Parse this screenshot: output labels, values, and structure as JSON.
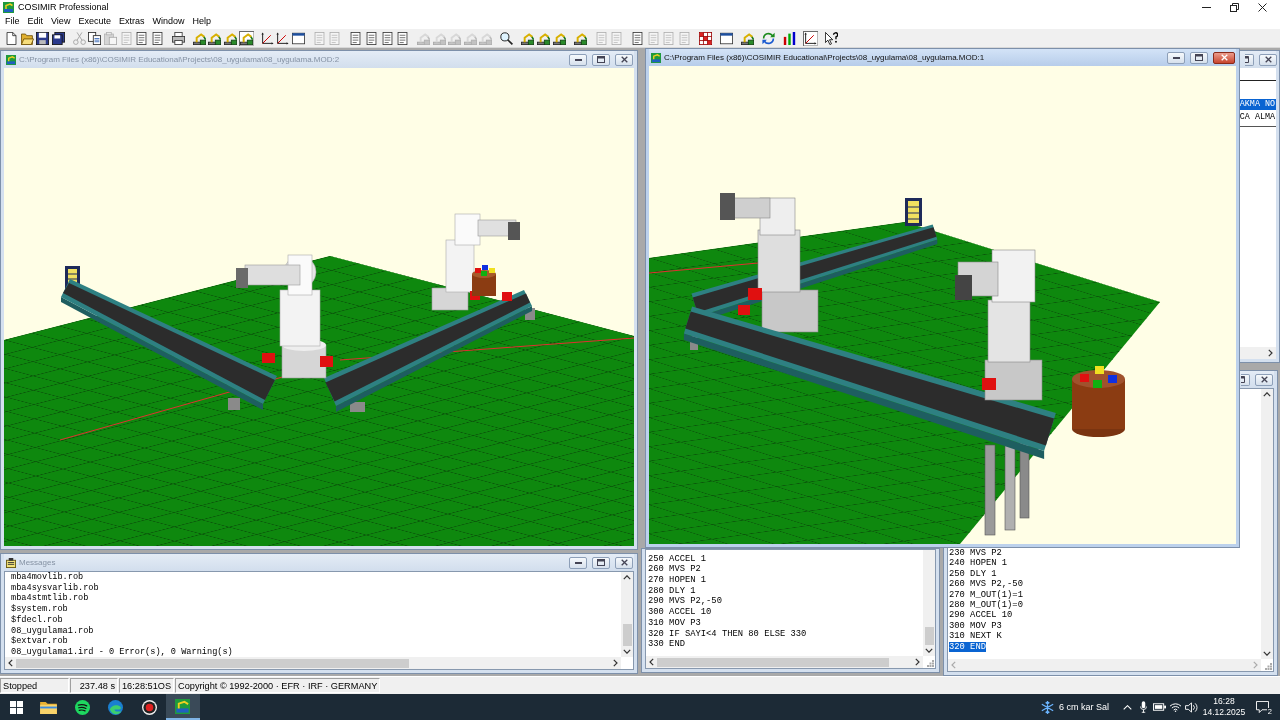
{
  "app": {
    "title": "COSIMIR Professional"
  },
  "menu": [
    "File",
    "Edit",
    "View",
    "Execute",
    "Extras",
    "Window",
    "Help"
  ],
  "toolbar": [
    [
      {
        "pressed": false,
        "disabled": false
      },
      {
        "pressed": false,
        "disabled": false
      },
      {
        "pressed": false,
        "disabled": false
      },
      {
        "pressed": false,
        "disabled": false
      }
    ],
    [
      {
        "pressed": false,
        "disabled": true
      },
      {
        "pressed": false,
        "disabled": false
      },
      {
        "pressed": false,
        "disabled": true
      },
      {
        "pressed": false,
        "disabled": true
      },
      {
        "pressed": false,
        "disabled": false
      },
      {
        "pressed": false,
        "disabled": false
      }
    ],
    [
      {
        "pressed": false,
        "disabled": false
      }
    ],
    [
      {
        "pressed": false,
        "disabled": false
      },
      {
        "pressed": false,
        "disabled": false
      },
      {
        "pressed": false,
        "disabled": false
      },
      {
        "pressed": true,
        "disabled": false
      }
    ],
    [
      {
        "pressed": false,
        "disabled": false
      },
      {
        "pressed": false,
        "disabled": false
      },
      {
        "pressed": false,
        "disabled": false
      }
    ],
    [
      {
        "pressed": false,
        "disabled": true
      },
      {
        "pressed": false,
        "disabled": true
      }
    ],
    [
      {
        "pressed": false,
        "disabled": false
      },
      {
        "pressed": false,
        "disabled": false
      },
      {
        "pressed": false,
        "disabled": false
      },
      {
        "pressed": false,
        "disabled": false
      }
    ],
    [
      {
        "pressed": false,
        "disabled": true
      },
      {
        "pressed": false,
        "disabled": true
      },
      {
        "pressed": false,
        "disabled": true
      },
      {
        "pressed": false,
        "disabled": true
      },
      {
        "pressed": false,
        "disabled": true
      }
    ],
    [
      {
        "pressed": false,
        "disabled": false
      }
    ],
    [
      {
        "pressed": false,
        "disabled": false
      },
      {
        "pressed": false,
        "disabled": false
      },
      {
        "pressed": false,
        "disabled": false
      }
    ],
    [
      {
        "pressed": false,
        "disabled": false
      }
    ],
    [
      {
        "pressed": false,
        "disabled": true
      },
      {
        "pressed": false,
        "disabled": true
      }
    ],
    [
      {
        "pressed": false,
        "disabled": false
      },
      {
        "pressed": false,
        "disabled": true
      },
      {
        "pressed": false,
        "disabled": true
      },
      {
        "pressed": false,
        "disabled": true
      }
    ],
    [
      {
        "pressed": false,
        "disabled": false
      }
    ],
    [
      {
        "pressed": false,
        "disabled": false
      }
    ],
    [
      {
        "pressed": false,
        "disabled": false
      }
    ],
    [
      {
        "pressed": false,
        "disabled": false
      }
    ],
    [
      {
        "pressed": false,
        "disabled": false
      }
    ],
    [
      {
        "pressed": true,
        "disabled": false
      }
    ],
    [
      {
        "pressed": false,
        "disabled": false
      }
    ]
  ],
  "viewports": [
    {
      "title": "C:\\Program Files (x86)\\COSIMIR Educational\\Projects\\08_uygulama\\08_uygulama.MOD:2",
      "active": false
    },
    {
      "title": "C:\\Program Files (x86)\\COSIMIR Educational\\Projects\\08_uygulama\\08_uygulama.MOD:1",
      "active": true
    }
  ],
  "side_list": {
    "items": [
      {
        "text": "AKMA NO",
        "selected": true
      },
      {
        "text": "CA ALMA",
        "selected": false
      }
    ]
  },
  "messages": {
    "title": "Messages",
    "active": false,
    "lines": [
      "mba4movlib.rob",
      "mba4sysvarlib.rob",
      "mba4stmtlib.rob",
      "$system.rob",
      "$fdecl.rob",
      "08_uygulama1.rob",
      "$extvar.rob",
      "08_uygulama1.ird - 0 Error(s), 0 Warning(s)"
    ]
  },
  "program_left": {
    "lines": [
      {
        "text": "250 ACCEL 1",
        "selected": false
      },
      {
        "text": "260 MVS P2",
        "selected": false
      },
      {
        "text": "270 HOPEN 1",
        "selected": false
      },
      {
        "text": "280 DLY 1",
        "selected": false
      },
      {
        "text": "290 MVS P2,-50",
        "selected": false
      },
      {
        "text": "300 ACCEL 10",
        "selected": false
      },
      {
        "text": "310 MOV P3",
        "selected": false
      },
      {
        "text": "320 IF SAYI<4 THEN 80 ELSE 330",
        "selected": false
      },
      {
        "text": "330 END",
        "selected": false
      }
    ]
  },
  "program_right": {
    "lines": [
      {
        "text": "230 MVS P2",
        "selected": false
      },
      {
        "text": "240 HOPEN 1",
        "selected": false
      },
      {
        "text": "250 DLY 1",
        "selected": false
      },
      {
        "text": "260 MVS P2,-50",
        "selected": false
      },
      {
        "text": "270 M_OUT(1)=1",
        "selected": false
      },
      {
        "text": "280 M_OUT(1)=0",
        "selected": false
      },
      {
        "text": "290 ACCEL 10",
        "selected": false
      },
      {
        "text": "300 MOV P3",
        "selected": false
      },
      {
        "text": "310 NEXT K",
        "selected": false
      },
      {
        "text": "320 END",
        "selected": true
      }
    ]
  },
  "status_bar": {
    "state": "Stopped",
    "elapsed": "237.48 s",
    "clock": "16:28:51OS",
    "copyright": "Copyright © 1992-2000 · EFR · IRF · GERMANY"
  },
  "taskbar": {
    "apps": [
      {
        "selected": false
      },
      {
        "selected": false
      },
      {
        "selected": false
      },
      {
        "selected": false
      },
      {
        "selected": true
      }
    ],
    "weather": "6 cm kar Sal",
    "time": "16:28",
    "date": "14.12.2025",
    "notifications": "2"
  }
}
